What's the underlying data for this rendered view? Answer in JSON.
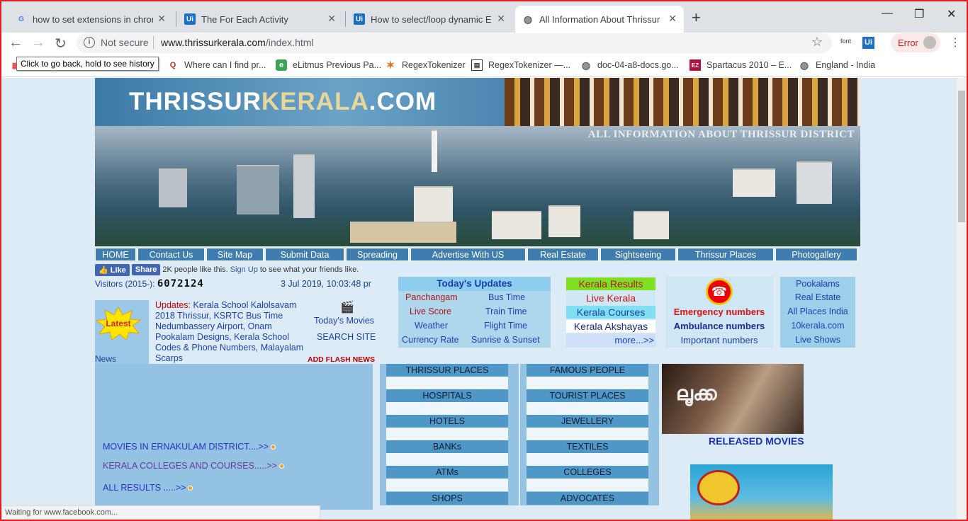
{
  "browser": {
    "tabs": [
      {
        "title": "how to set extensions in chrome",
        "icon": "google-icon"
      },
      {
        "title": "The For Each Activity",
        "icon": "uipath-icon"
      },
      {
        "title": "How to select/loop dynamic Elem",
        "icon": "uipath-icon"
      },
      {
        "title": "All Information About Thrissur Di",
        "icon": "globe-icon",
        "active": true
      }
    ],
    "url_host": "www.thrissurkerala.com",
    "url_path": "/index.html",
    "security_label": "Not secure",
    "ext_font": "font",
    "ext_ui": "Ui",
    "error_label": "Error",
    "tooltip": "Click to go back, hold to see history",
    "bookmarks": [
      {
        "label": "Where can I find pr...",
        "icon": "quora-icon"
      },
      {
        "label": "eLitmus Previous Pa...",
        "icon": "elitmus-icon"
      },
      {
        "label": "RegexTokenizer",
        "icon": "spark-icon"
      },
      {
        "label": "RegexTokenizer —...",
        "icon": "doc-icon"
      },
      {
        "label": "doc-04-a8-docs.go...",
        "icon": "globe-icon"
      },
      {
        "label": "Spartacus 2010 – E...",
        "icon": "ez-icon"
      },
      {
        "label": "England - India",
        "icon": "globe-icon"
      }
    ],
    "status_text": "Waiting for www.facebook.com..."
  },
  "site": {
    "logo_a": "THRISSUR",
    "logo_b": "KERALA",
    "logo_c": ".COM",
    "tagline": "ALL INFORMATION ABOUT THRISSUR DISTRICT",
    "nav": [
      "HOME",
      "Contact Us",
      "Site Map",
      "Submit Data",
      "Spreading",
      "Advertise With US",
      "Real Estate",
      "Sightseeing",
      "Thrissur Places",
      "Photogallery"
    ],
    "fb_like": "Like",
    "fb_share": "Share",
    "fb_text_a": "2K people like this.",
    "fb_signup": "Sign Up",
    "fb_text_b": "to see what your friends like.",
    "visitors_label": "Visitors (2015-):",
    "visitors_count": "6072124",
    "clock": "3 Jul 2019, 10:03:48 pr",
    "latest_badge": "Latest",
    "news_label": "News",
    "updates_label": "Updates:",
    "updates_text": "Kerala School Kalolsavam 2018 Thrissur, KSRTC Bus Time Nedumbassery Airport, Onam Pookalam Designs, Kerala School Codes & Phone Numbers, Malayalam Scarps",
    "todays_movies": "Today's Movies",
    "search_site": "SEARCH SITE",
    "add_flash": "ADD FLASH NEWS",
    "today_updates": {
      "title": "Today's Updates",
      "left": [
        "Panchangam",
        "Live Score",
        "Weather",
        "Currency Rate"
      ],
      "right": [
        "Bus Time",
        "Train Time",
        "Flight Time",
        "Sunrise & Sunset"
      ]
    },
    "kerala_links": [
      "Kerala Results",
      "Live Kerala",
      "Kerala Courses",
      "Kerala Akshayas",
      "more...>>"
    ],
    "emergency": [
      "Emergency numbers",
      "Ambulance numbers",
      "Important numbers"
    ],
    "right_links": [
      "Pookalams",
      "Real Estate",
      "All Places India",
      "10kerala.com",
      "Live Shows"
    ],
    "panel_links": [
      "MOVIES IN ERNAKULAM DISTRICT....>>",
      "KERALA COLLEGES AND COURSES.....>>",
      "ALL RESULTS .....>>"
    ],
    "col1": [
      "THRISSUR PLACES",
      "HOSPITALS",
      "HOTELS",
      "BANKs",
      "ATMs",
      "SHOPS"
    ],
    "col2": [
      "FAMOUS PEOPLE",
      "TOURIST PLACES",
      "JEWELLERY",
      "TEXTILES",
      "COLLEGES",
      "ADVOCATES"
    ],
    "released_movies": "RELEASED MOVIES"
  }
}
